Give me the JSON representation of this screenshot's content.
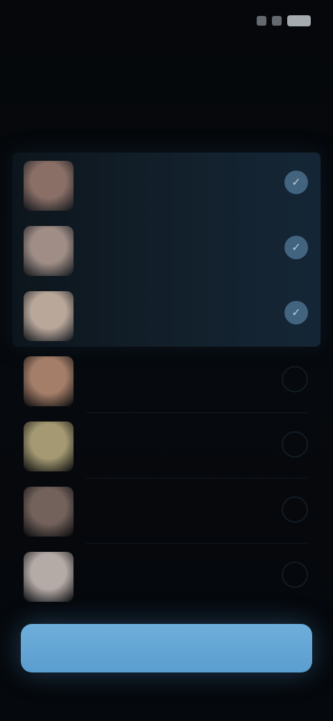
{
  "status_bar": {
    "time": "",
    "icons": [
      "signal-icon",
      "wifi-icon",
      "battery-icon"
    ]
  },
  "header": {
    "title": "",
    "skip_label": "",
    "headline": ""
  },
  "list": {
    "rows": [
      {
        "name": "",
        "sub": "",
        "selected": true,
        "avatar_color": "#8a6f66"
      },
      {
        "name": "",
        "sub": "",
        "selected": true,
        "avatar_color": "#9f8d86"
      },
      {
        "name": "",
        "sub": "",
        "selected": true,
        "avatar_color": "#b9a79a"
      },
      {
        "name": "",
        "sub": "",
        "selected": false,
        "avatar_color": "#a47e69"
      },
      {
        "name": "",
        "sub": "",
        "selected": false,
        "avatar_color": "#a49972"
      },
      {
        "name": "",
        "sub": "",
        "selected": false,
        "avatar_color": "#73625b"
      },
      {
        "name": "",
        "sub": "",
        "selected": false,
        "avatar_color": "#b4aaa6"
      }
    ]
  },
  "cta": {
    "label": ""
  },
  "colors": {
    "accent": "#6eaedb",
    "panel": "#13212d",
    "background": "#05070a"
  }
}
